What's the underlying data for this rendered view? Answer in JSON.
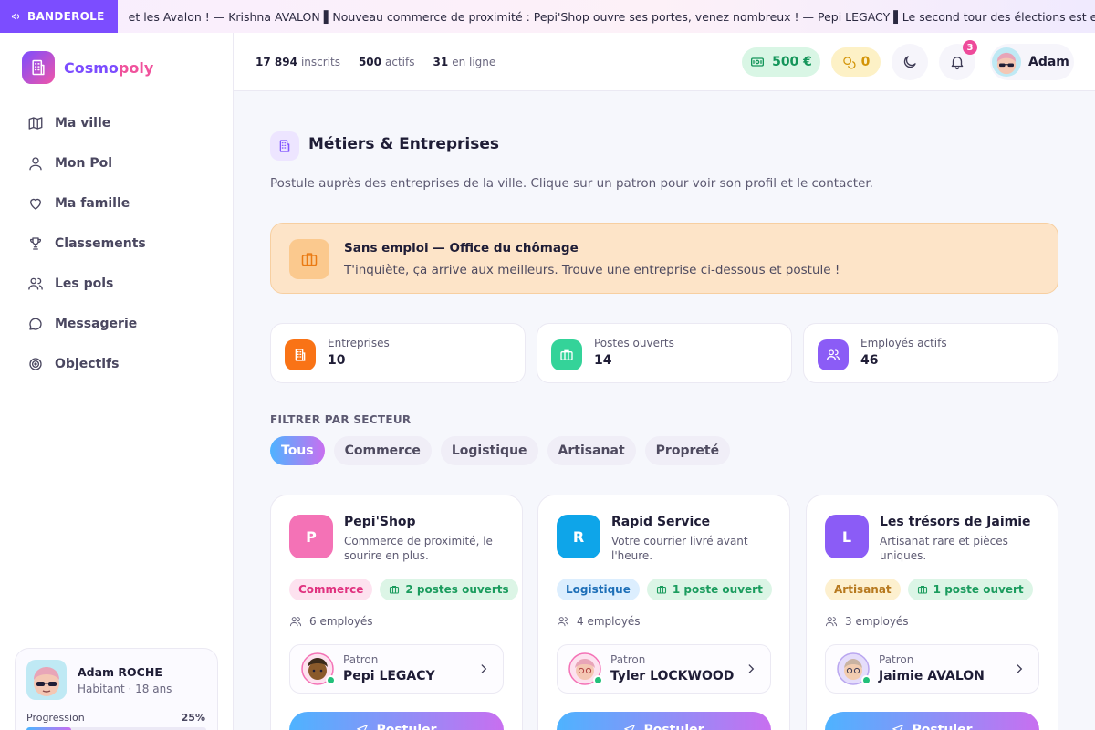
{
  "ticker": {
    "label": "BANDEROLE",
    "text": "et les Avalon ! — Krishna AVALON     ▌Nouveau commerce de proximité : Pepi'Shop ouvre ses portes, venez nombreux ! — Pepi LEGACY     ▌Le second tour des élections est en"
  },
  "sidebar": {
    "logo": {
      "part1": "Cosmo",
      "part2": "poly"
    },
    "items": [
      {
        "label": "Ma ville",
        "icon": "map-icon"
      },
      {
        "label": "Mon Pol",
        "icon": "user-icon"
      },
      {
        "label": "Ma famille",
        "icon": "heart-icon"
      },
      {
        "label": "Classements",
        "icon": "trophy-icon"
      },
      {
        "label": "Les pols",
        "icon": "users-icon"
      },
      {
        "label": "Messagerie",
        "icon": "chat-icon"
      },
      {
        "label": "Objectifs",
        "icon": "target-icon"
      }
    ],
    "user": {
      "name": "Adam ROCHE",
      "sub": "Habitant · 18 ans",
      "progress_label": "Progression",
      "progress_value": "25%",
      "progress": 0.25
    }
  },
  "header": {
    "stats": [
      {
        "value": "17 894",
        "label": "inscrits"
      },
      {
        "value": "500",
        "label": "actifs"
      },
      {
        "value": "31",
        "label": "en ligne"
      }
    ],
    "money": "500 €",
    "coins": "0",
    "notifications": "3",
    "user": "Adam"
  },
  "page": {
    "title": "Métiers & Entreprises",
    "description": "Postule auprès des entreprises de la ville. Clique sur un patron pour voir son profil et le contacter."
  },
  "alert": {
    "title": "Sans emploi — Office du chômage",
    "text": "T'inquiète, ça arrive aux meilleurs. Trouve une entreprise ci-dessous et postule !"
  },
  "stats": [
    {
      "label": "Entreprises",
      "value": "10",
      "color": "#f97316"
    },
    {
      "label": "Postes ouverts",
      "value": "14",
      "color": "#34d399"
    },
    {
      "label": "Employés actifs",
      "value": "46",
      "color": "#8b5cf6"
    }
  ],
  "filters": {
    "label": "FILTRER PAR SECTEUR",
    "chips": [
      "Tous",
      "Commerce",
      "Logistique",
      "Artisanat",
      "Propreté"
    ],
    "active": "Tous"
  },
  "companies": [
    {
      "letter": "P",
      "name": "Pepi'Shop",
      "description": "Commerce de proximité, le sourire en plus.",
      "sector": "Commerce",
      "sector_bg": "#fde2ef",
      "sector_fg": "#e0317f",
      "open": "2 postes ouverts",
      "employees": "6 employés",
      "boss_label": "Patron",
      "boss": "Pepi LEGACY",
      "color": "#f472b6",
      "apply": "Postuler"
    },
    {
      "letter": "R",
      "name": "Rapid Service",
      "description": "Votre courrier livré avant l'heure.",
      "sector": "Logistique",
      "sector_bg": "#dceefe",
      "sector_fg": "#1e6fb8",
      "open": "1 poste ouvert",
      "employees": "4 employés",
      "boss_label": "Patron",
      "boss": "Tyler LOCKWOOD",
      "color": "#0ea5e9",
      "apply": "Postuler"
    },
    {
      "letter": "L",
      "name": "Les trésors de Jaimie",
      "description": "Artisanat rare et pièces uniques.",
      "sector": "Artisanat",
      "sector_bg": "#fdf0cf",
      "sector_fg": "#b7791f",
      "open": "1 poste ouvert",
      "employees": "3 employés",
      "boss_label": "Patron",
      "boss": "Jaimie AVALON",
      "color": "#8b5cf6",
      "apply": "Postuler"
    }
  ]
}
